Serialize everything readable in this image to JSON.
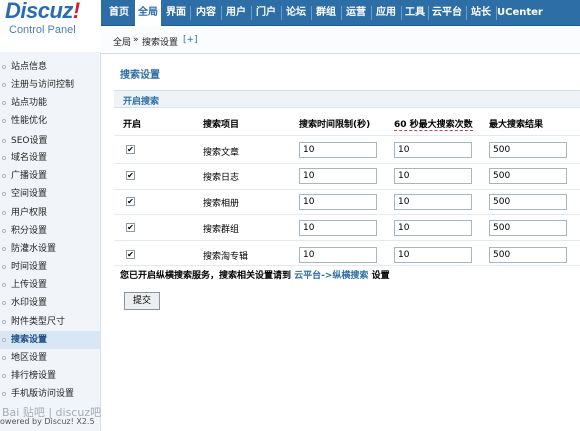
{
  "logo": {
    "brand": "Discuz",
    "bang": "!",
    "subtitle": "Control Panel"
  },
  "topnav": [
    "首页",
    "全局",
    "界面",
    "内容",
    "用户",
    "门户",
    "论坛",
    "群组",
    "运营",
    "应用",
    "工具",
    "云平台",
    "站长",
    "UCenter"
  ],
  "breadcrumb": {
    "root": "全局",
    "sep": "»",
    "current": "搜索设置",
    "add": "[+]"
  },
  "sidebar": {
    "items": [
      "站点信息",
      "注册与访问控制",
      "站点功能",
      "性能优化",
      "SEO设置",
      "域名设置",
      "广播设置",
      "空间设置",
      "用户权限",
      "积分设置",
      "防灌水设置",
      "时间设置",
      "上传设置",
      "水印设置",
      "附件类型尺寸",
      "搜索设置",
      "地区设置",
      "排行榜设置",
      "手机版访问设置"
    ],
    "active": "搜索设置"
  },
  "footer_text": "owered by Discuz! X2.5",
  "main": {
    "title": "搜索设置",
    "subtitle": "开启搜索",
    "headers": {
      "enable": "开启",
      "item": "搜索项目",
      "time_limit": "搜索时间限制(秒)",
      "max_per_60s": "60 秒最大搜索次数",
      "max_results": "最大搜索结果"
    },
    "rows": [
      {
        "checked": true,
        "label": "搜索文章",
        "time_limit": "10",
        "max_per_60s": "10",
        "max_results": "500"
      },
      {
        "checked": true,
        "label": "搜索日志",
        "time_limit": "10",
        "max_per_60s": "10",
        "max_results": "500"
      },
      {
        "checked": true,
        "label": "搜索相册",
        "time_limit": "10",
        "max_per_60s": "10",
        "max_results": "500"
      },
      {
        "checked": true,
        "label": "搜索群组",
        "time_limit": "10",
        "max_per_60s": "10",
        "max_results": "500"
      },
      {
        "checked": true,
        "label": "搜索淘专辑",
        "time_limit": "10",
        "max_per_60s": "10",
        "max_results": "500"
      }
    ],
    "note_prefix": "您已开启纵横搜索服务，搜索相关设置请到",
    "note_link": "云平台->纵横搜索",
    "note_suffix": "设置",
    "submit": "提交"
  },
  "watermark": "Bai 贴吧 | discuz吧",
  "colors": {
    "nav_bg": "#2e6ea6",
    "accent": "#2e6ea6",
    "sidebar_bg": "#f1f5f9"
  }
}
